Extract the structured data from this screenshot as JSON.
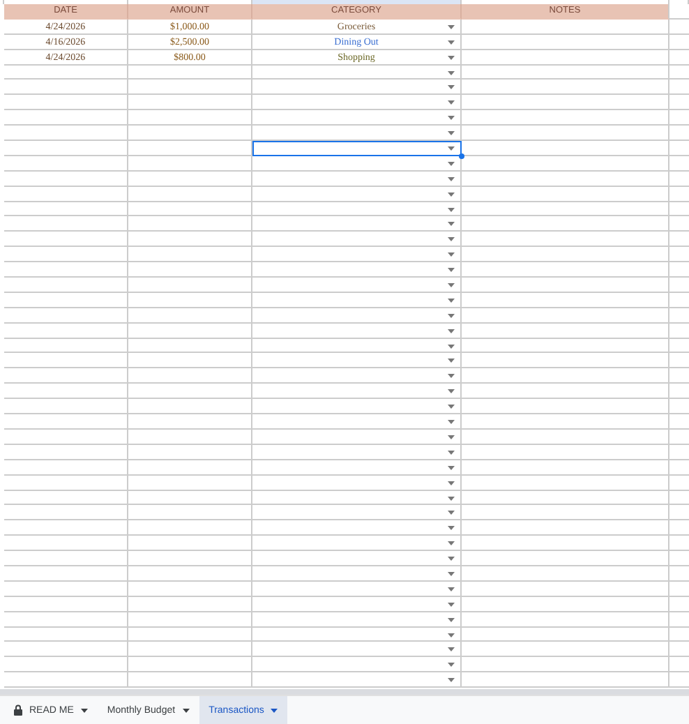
{
  "table": {
    "columns": [
      "DATE",
      "AMOUNT",
      "CATEGORY",
      "NOTES"
    ],
    "rows": [
      {
        "date": "4/24/2026",
        "amount": "$1,000.00",
        "category": "Groceries",
        "color": "#7a5c3a",
        "selected": false
      },
      {
        "date": "4/16/2026",
        "amount": "$2,500.00",
        "category": "Dining Out",
        "color": "#3b6fd1",
        "selected": false
      },
      {
        "date": "4/24/2026",
        "amount": "$800.00",
        "category": "Shopping",
        "color": "#6e6a2a",
        "selected": false
      },
      {
        "selected": false
      },
      {
        "selected": false
      },
      {
        "selected": false
      },
      {
        "selected": false
      },
      {
        "selected": false
      },
      {
        "selected": true
      },
      {
        "selected": false
      },
      {
        "selected": false
      },
      {
        "selected": false
      },
      {
        "selected": false
      },
      {
        "selected": false
      },
      {
        "selected": false
      },
      {
        "selected": false
      },
      {
        "selected": false
      },
      {
        "selected": false
      },
      {
        "selected": false
      },
      {
        "selected": false
      },
      {
        "selected": false
      },
      {
        "selected": false
      },
      {
        "selected": false
      },
      {
        "selected": false
      },
      {
        "selected": false
      },
      {
        "selected": false
      },
      {
        "selected": false
      },
      {
        "selected": false
      },
      {
        "selected": false
      },
      {
        "selected": false
      },
      {
        "selected": false
      },
      {
        "selected": false
      },
      {
        "selected": false
      },
      {
        "selected": false
      },
      {
        "selected": false
      },
      {
        "selected": false
      },
      {
        "selected": false
      },
      {
        "selected": false
      },
      {
        "selected": false
      },
      {
        "selected": false
      },
      {
        "selected": false
      },
      {
        "selected": false
      },
      {
        "selected": false
      },
      {
        "selected": false
      }
    ]
  },
  "sheet_tabs": [
    {
      "label": "READ ME",
      "locked": true,
      "selected": false
    },
    {
      "label": "Monthly Budget",
      "locked": false,
      "selected": false
    },
    {
      "label": "Transactions",
      "locked": false,
      "selected": true
    }
  ]
}
